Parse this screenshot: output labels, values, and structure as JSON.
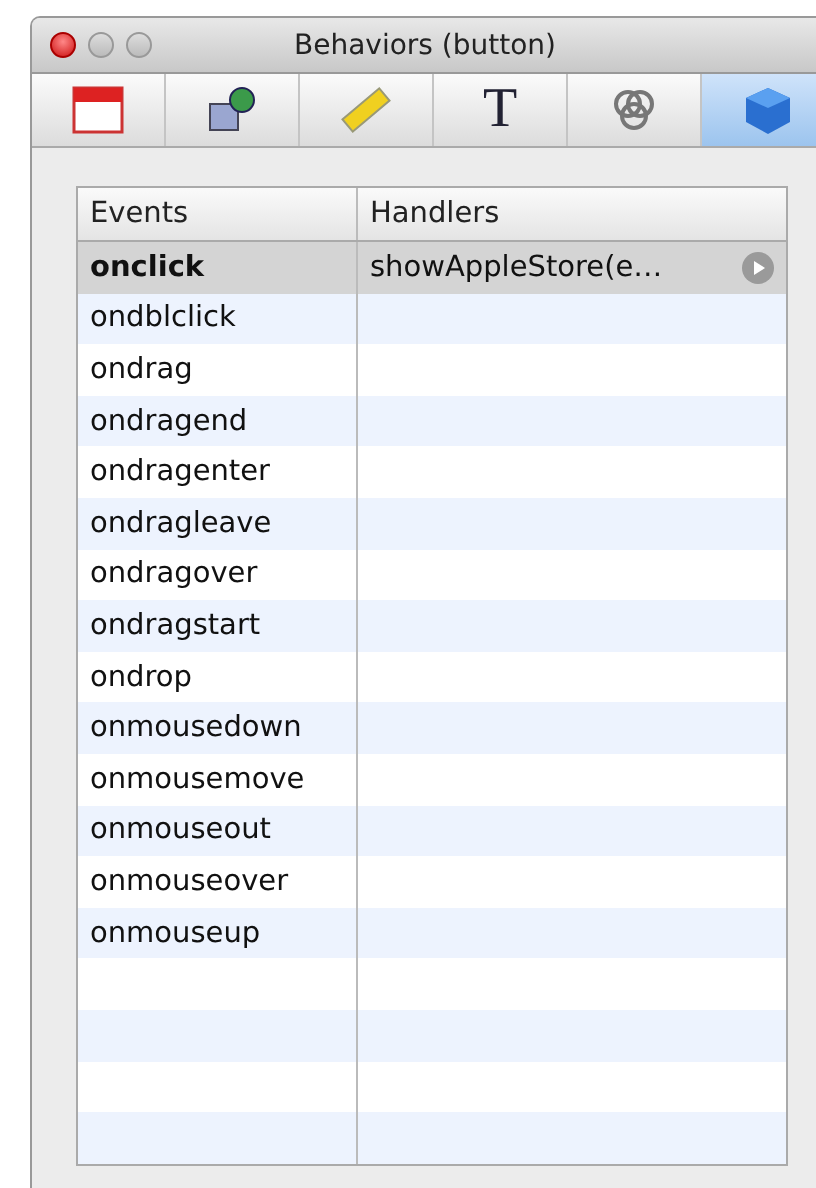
{
  "window": {
    "title": "Behaviors (button)"
  },
  "toolbar": [
    {
      "kind": "calendar",
      "selected": false
    },
    {
      "kind": "shapes",
      "selected": false
    },
    {
      "kind": "ruler",
      "selected": false
    },
    {
      "kind": "text",
      "label": "T",
      "selected": false
    },
    {
      "kind": "rings",
      "selected": false
    },
    {
      "kind": "cube",
      "selected": true
    }
  ],
  "table": {
    "columns": [
      "Events",
      "Handlers"
    ],
    "rows": [
      {
        "event": "onclick",
        "handler": "showAppleStore(e…",
        "selected": true
      },
      {
        "event": "ondblclick",
        "selected": false
      },
      {
        "event": "ondrag",
        "selected": false
      },
      {
        "event": "ondragend",
        "selected": false
      },
      {
        "event": "ondragenter",
        "selected": false
      },
      {
        "event": "ondragleave",
        "selected": false
      },
      {
        "event": "ondragover",
        "selected": false
      },
      {
        "event": "ondragstart",
        "selected": false
      },
      {
        "event": "ondrop",
        "selected": false
      },
      {
        "event": "onmousedown",
        "selected": false
      },
      {
        "event": "onmousemove",
        "selected": false
      },
      {
        "event": "onmouseout",
        "selected": false
      },
      {
        "event": "onmouseover",
        "selected": false
      },
      {
        "event": "onmouseup",
        "selected": false
      }
    ]
  }
}
